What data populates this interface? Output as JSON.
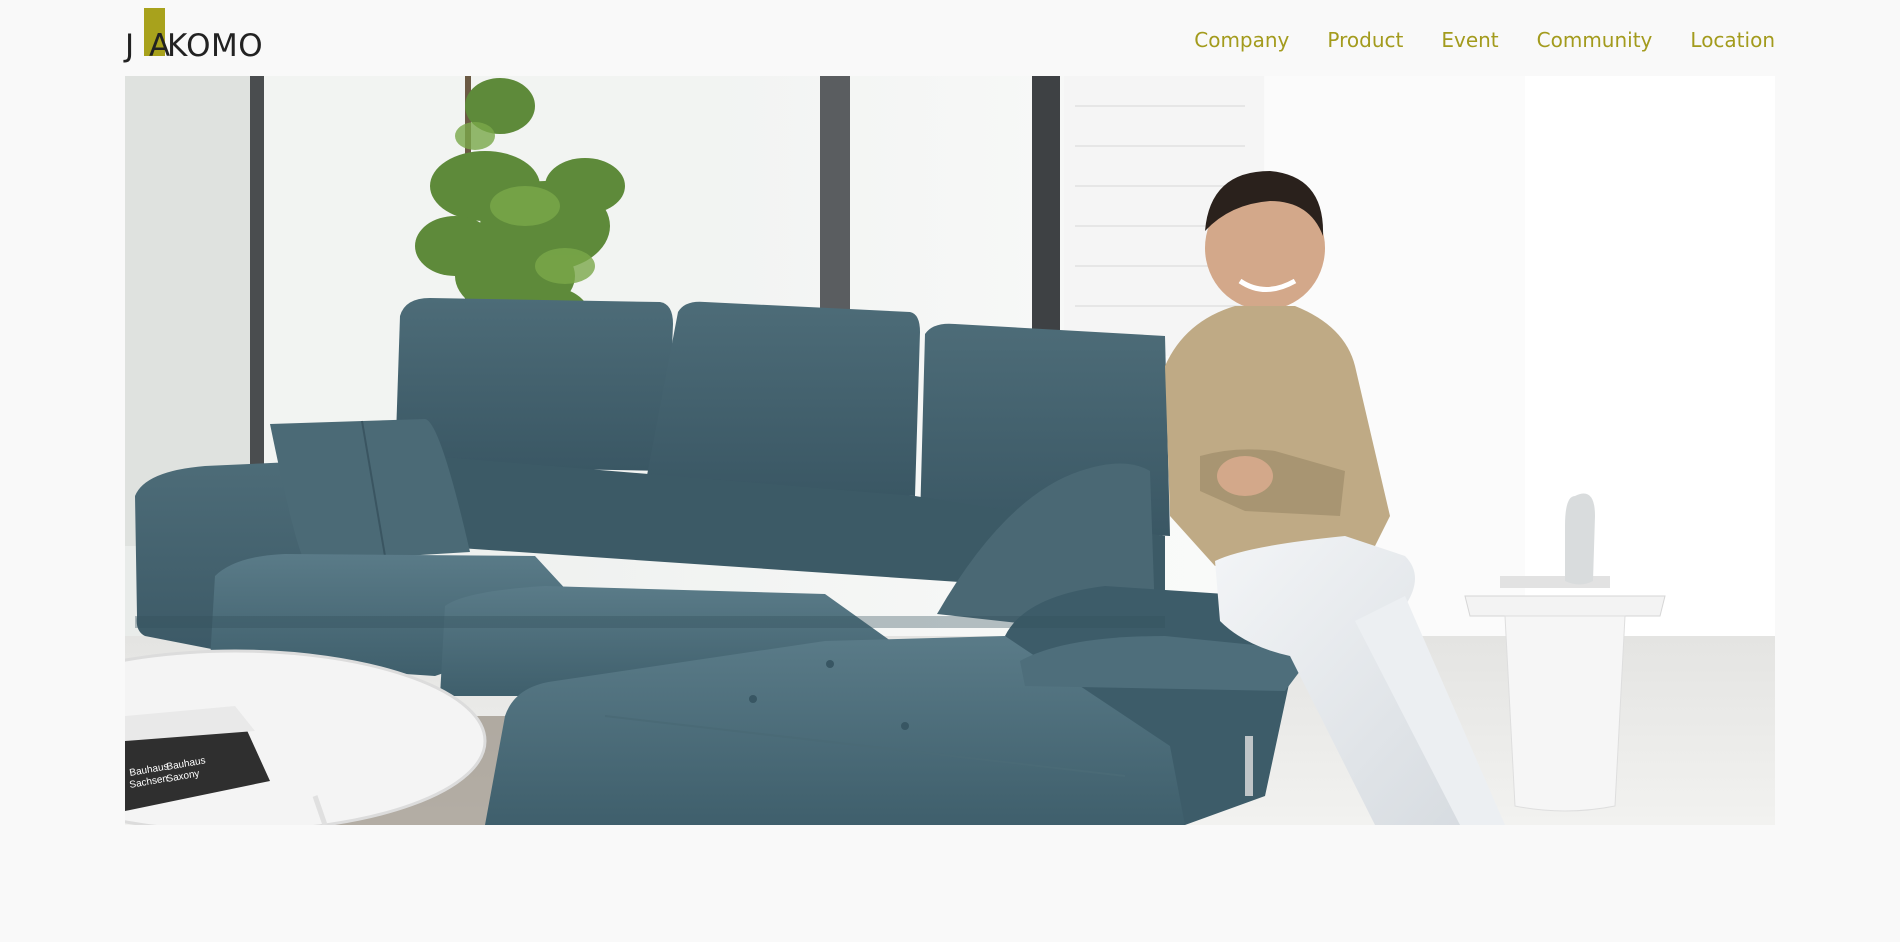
{
  "brand": {
    "logo_text": "JAKOMO",
    "logo_left": "J",
    "logo_mid": "A",
    "logo_right": "KOMO",
    "accent_color": "#a39b1d",
    "logo_block_color": "#a8a21c"
  },
  "nav": {
    "items": [
      {
        "label": "Company"
      },
      {
        "label": "Product"
      },
      {
        "label": "Event"
      },
      {
        "label": "Community"
      },
      {
        "label": "Location"
      }
    ],
    "color": "#a39b1d"
  },
  "hero": {
    "image": "living-room-photo",
    "book_title_1": "Bauhaus",
    "book_title_2": "Sachsen",
    "book_title_3": "Bauhaus",
    "book_title_4": "Saxony"
  }
}
